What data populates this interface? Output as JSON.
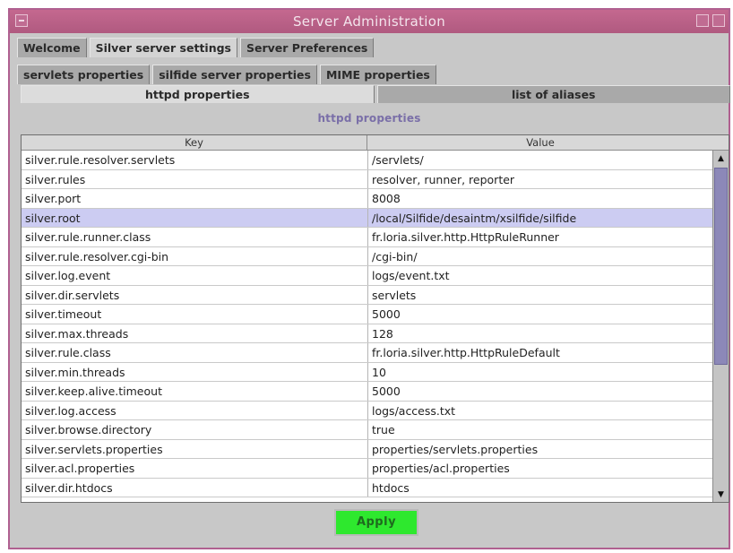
{
  "window": {
    "title": "Server Administration"
  },
  "tabs_level1": [
    {
      "label": "Welcome",
      "active": false
    },
    {
      "label": "Silver server settings",
      "active": true
    },
    {
      "label": "Server Preferences",
      "active": false
    }
  ],
  "tabs_level2": [
    {
      "label": "servlets properties",
      "active": false
    },
    {
      "label": "silfide server properties",
      "active": false
    },
    {
      "label": "MIME properties",
      "active": true
    }
  ],
  "tabs_level3": [
    {
      "label": "httpd properties",
      "active": true
    },
    {
      "label": "list of aliases",
      "active": false
    }
  ],
  "section_title": "httpd properties",
  "table": {
    "headers": {
      "key": "Key",
      "value": "Value"
    },
    "rows": [
      {
        "key": "silver.rule.resolver.servlets",
        "value": "/servlets/"
      },
      {
        "key": "silver.rules",
        "value": "resolver, runner, reporter"
      },
      {
        "key": "silver.port",
        "value": "8008"
      },
      {
        "key": "silver.root",
        "value": "/local/Silfide/desaintm/xsilfide/silfide"
      },
      {
        "key": "silver.rule.runner.class",
        "value": "fr.loria.silver.http.HttpRuleRunner"
      },
      {
        "key": "silver.rule.resolver.cgi-bin",
        "value": "/cgi-bin/"
      },
      {
        "key": "silver.log.event",
        "value": "logs/event.txt"
      },
      {
        "key": "silver.dir.servlets",
        "value": "servlets"
      },
      {
        "key": "silver.timeout",
        "value": "5000"
      },
      {
        "key": "silver.max.threads",
        "value": "128"
      },
      {
        "key": "silver.rule.class",
        "value": "fr.loria.silver.http.HttpRuleDefault"
      },
      {
        "key": "silver.min.threads",
        "value": "10"
      },
      {
        "key": "silver.keep.alive.timeout",
        "value": "5000"
      },
      {
        "key": "silver.log.access",
        "value": "logs/access.txt"
      },
      {
        "key": "silver.browse.directory",
        "value": "true"
      },
      {
        "key": "silver.servlets.properties",
        "value": "properties/servlets.properties"
      },
      {
        "key": "silver.acl.properties",
        "value": "properties/acl.properties"
      },
      {
        "key": "silver.dir.htdocs",
        "value": "htdocs"
      }
    ],
    "selected_index": 3
  },
  "scrollbar": {
    "up_icon": "scroll-up-arrow-icon",
    "down_icon": "scroll-down-arrow-icon"
  },
  "apply_label": "Apply",
  "colors": {
    "titlebar": "#b85f87",
    "selection": "#ccccf2",
    "apply": "#2ee82e",
    "section_title": "#7a6fa8"
  }
}
